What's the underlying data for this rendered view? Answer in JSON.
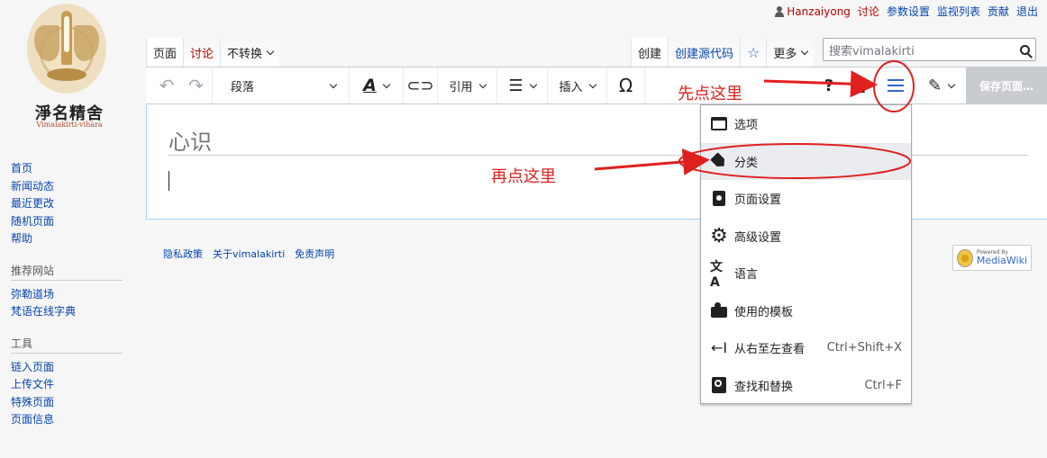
{
  "personal": {
    "username": "Hanzaiyong",
    "links": [
      "讨论",
      "参数设置",
      "监视列表",
      "贡献",
      "退出"
    ]
  },
  "logo": {
    "name": "淨名精舍",
    "subtitle": "Vimalakirti-vihāra"
  },
  "sidebar": {
    "nav": [
      "首页",
      "新闻动态",
      "最近更改",
      "随机页面",
      "帮助"
    ],
    "section2": {
      "heading": "推荐网站",
      "items": [
        "弥勒道场",
        "梵语在线字典"
      ]
    },
    "section3": {
      "heading": "工具",
      "items": [
        "链入页面",
        "上传文件",
        "特殊页面",
        "页面信息"
      ]
    }
  },
  "tabs": {
    "left": [
      "页面",
      "讨论",
      "不转换"
    ],
    "right": [
      "创建",
      "创建源代码",
      "更多"
    ]
  },
  "search": {
    "placeholder": "搜索vimalakirti"
  },
  "toolbar": {
    "format": "段落",
    "cite": "引用",
    "insert": "插入",
    "save": "保存页面…"
  },
  "page": {
    "title": "心识"
  },
  "footer": [
    "隐私政策",
    "关于vimalakirti",
    "免责声明"
  ],
  "badge": {
    "small": "Powered By",
    "big": "MediaWiki"
  },
  "menu": {
    "items": [
      {
        "label": "选项",
        "shortcut": ""
      },
      {
        "label": "分类",
        "shortcut": ""
      },
      {
        "label": "页面设置",
        "shortcut": ""
      },
      {
        "label": "高级设置",
        "shortcut": ""
      },
      {
        "label": "语言",
        "shortcut": ""
      },
      {
        "label": "使用的模板",
        "shortcut": ""
      },
      {
        "label": "从右至左查看",
        "shortcut": "Ctrl+Shift+X"
      },
      {
        "label": "查找和替换",
        "shortcut": "Ctrl+F"
      }
    ]
  },
  "annotations": {
    "first": "先点这里",
    "second": "再点这里",
    "color": "#e0201e"
  }
}
